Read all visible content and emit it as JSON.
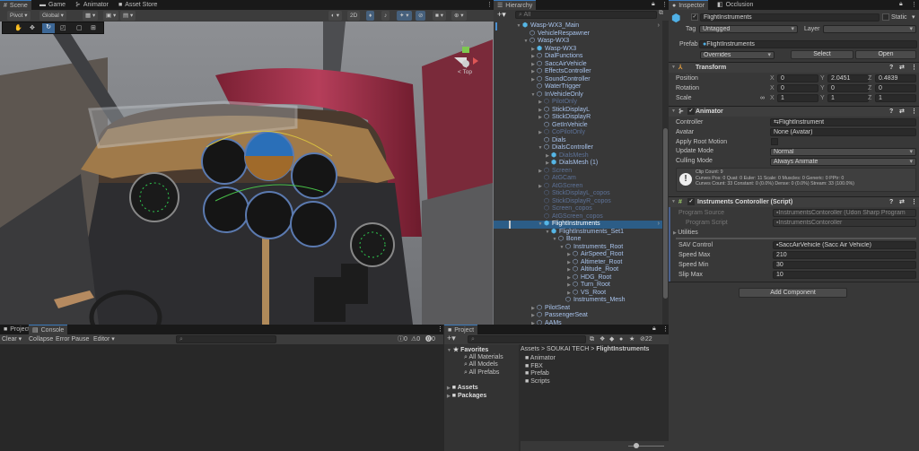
{
  "scene_panel": {
    "tabs": [
      "Scene",
      "Game",
      "Animator",
      "Asset Store"
    ],
    "pivot": "Pivot",
    "global": "Global",
    "btn_2d": "2D",
    "gizmo_label": "< Top",
    "gizmo_y": "Y"
  },
  "hierarchy": {
    "tab": "Hierarchy",
    "search_placeholder": "All",
    "items": [
      {
        "label": "Wasp-WX3_Main",
        "depth": 0,
        "arrow": "down",
        "prefab": true,
        "inactive": false
      },
      {
        "label": "VehicleRespawner",
        "depth": 1,
        "arrow": "",
        "prefab": false,
        "inactive": false
      },
      {
        "label": "Wasp-WX3",
        "depth": 1,
        "arrow": "down",
        "prefab": false,
        "inactive": false
      },
      {
        "label": "Wasp-WX3",
        "depth": 2,
        "arrow": "right",
        "prefab": true,
        "inactive": false
      },
      {
        "label": "DialFunctions",
        "depth": 2,
        "arrow": "right",
        "prefab": false,
        "inactive": false
      },
      {
        "label": "SaccAirVehicle",
        "depth": 2,
        "arrow": "right",
        "prefab": false,
        "inactive": false
      },
      {
        "label": "EffectsController",
        "depth": 2,
        "arrow": "right",
        "prefab": false,
        "inactive": false
      },
      {
        "label": "SoundController",
        "depth": 2,
        "arrow": "right",
        "prefab": false,
        "inactive": false
      },
      {
        "label": "WaterTrigger",
        "depth": 2,
        "arrow": "",
        "prefab": false,
        "inactive": false
      },
      {
        "label": "InVehicleOnly",
        "depth": 2,
        "arrow": "down",
        "prefab": false,
        "inactive": false
      },
      {
        "label": "PilotOnly",
        "depth": 3,
        "arrow": "right",
        "prefab": false,
        "inactive": true
      },
      {
        "label": "StickDisplayL",
        "depth": 3,
        "arrow": "right",
        "prefab": false,
        "inactive": false
      },
      {
        "label": "StickDisplayR",
        "depth": 3,
        "arrow": "right",
        "prefab": false,
        "inactive": false
      },
      {
        "label": "GetInVehicle",
        "depth": 3,
        "arrow": "",
        "prefab": false,
        "inactive": false
      },
      {
        "label": "CoPilotOnly",
        "depth": 3,
        "arrow": "right",
        "prefab": false,
        "inactive": true
      },
      {
        "label": "Dials",
        "depth": 3,
        "arrow": "",
        "prefab": false,
        "inactive": false
      },
      {
        "label": "DialsController",
        "depth": 3,
        "arrow": "down",
        "prefab": false,
        "inactive": false
      },
      {
        "label": "DialsMesh",
        "depth": 4,
        "arrow": "right",
        "prefab": true,
        "inactive": true
      },
      {
        "label": "DialsMesh (1)",
        "depth": 4,
        "arrow": "right",
        "prefab": true,
        "inactive": false
      },
      {
        "label": "Screen",
        "depth": 3,
        "arrow": "right",
        "prefab": false,
        "inactive": true
      },
      {
        "label": "AtGCam",
        "depth": 3,
        "arrow": "",
        "prefab": false,
        "inactive": true
      },
      {
        "label": "AtGScreen",
        "depth": 3,
        "arrow": "right",
        "prefab": false,
        "inactive": true
      },
      {
        "label": "StickDisplayL_copos",
        "depth": 3,
        "arrow": "",
        "prefab": false,
        "inactive": true
      },
      {
        "label": "StickDisplayR_copos",
        "depth": 3,
        "arrow": "",
        "prefab": false,
        "inactive": true
      },
      {
        "label": "Screen_copos",
        "depth": 3,
        "arrow": "",
        "prefab": false,
        "inactive": true
      },
      {
        "label": "AtGScreen_copos",
        "depth": 3,
        "arrow": "",
        "prefab": false,
        "inactive": true
      },
      {
        "label": "FlightInstruments",
        "depth": 3,
        "arrow": "down",
        "prefab": true,
        "inactive": false,
        "selected": true
      },
      {
        "label": "FlightInstruments_Set1",
        "depth": 4,
        "arrow": "down",
        "prefab": true,
        "inactive": false
      },
      {
        "label": "Bone",
        "depth": 5,
        "arrow": "down",
        "prefab": false,
        "inactive": false
      },
      {
        "label": "Instruments_Root",
        "depth": 6,
        "arrow": "down",
        "prefab": false,
        "inactive": false
      },
      {
        "label": "AirSpeed_Root",
        "depth": 7,
        "arrow": "right",
        "prefab": false,
        "inactive": false
      },
      {
        "label": "Altimeter_Root",
        "depth": 7,
        "arrow": "right",
        "prefab": false,
        "inactive": false
      },
      {
        "label": "Altitude_Root",
        "depth": 7,
        "arrow": "right",
        "prefab": false,
        "inactive": false
      },
      {
        "label": "HDG_Root",
        "depth": 7,
        "arrow": "right",
        "prefab": false,
        "inactive": false
      },
      {
        "label": "Turn_Root",
        "depth": 7,
        "arrow": "right",
        "prefab": false,
        "inactive": false
      },
      {
        "label": "VS_Root",
        "depth": 7,
        "arrow": "right",
        "prefab": false,
        "inactive": false
      },
      {
        "label": "Instruments_Mesh",
        "depth": 6,
        "arrow": "",
        "prefab": false,
        "inactive": false
      },
      {
        "label": "PilotSeat",
        "depth": 2,
        "arrow": "right",
        "prefab": false,
        "inactive": false
      },
      {
        "label": "PassengerSeat",
        "depth": 2,
        "arrow": "right",
        "prefab": false,
        "inactive": false
      },
      {
        "label": "AAMs",
        "depth": 2,
        "arrow": "right",
        "prefab": false,
        "inactive": false
      }
    ]
  },
  "inspector": {
    "tabs": [
      "Inspector",
      "Occlusion"
    ],
    "object_name": "FlightInstruments",
    "static_label": "Static",
    "tag_label": "Tag",
    "tag_value": "Untagged",
    "layer_label": "Layer",
    "layer_value": "",
    "prefab_label": "Prefab",
    "prefab_value": "FlightInstruments",
    "overrides": "Overrides",
    "select": "Select",
    "open": "Open",
    "transform": {
      "title": "Transform",
      "position_label": "Position",
      "rotation_label": "Rotation",
      "scale_label": "Scale",
      "position": [
        "0",
        "2.0451",
        "0.4839"
      ],
      "rotation": [
        "0",
        "0",
        "0"
      ],
      "scale": [
        "1",
        "1",
        "1"
      ],
      "axes": [
        "X",
        "Y",
        "Z"
      ]
    },
    "animator": {
      "title": "Animator",
      "controller_label": "Controller",
      "controller": "FlightInstrument",
      "avatar_label": "Avatar",
      "avatar": "None (Avatar)",
      "apply_root_motion_label": "Apply Root Motion",
      "update_mode_label": "Update Mode",
      "update_mode": "Normal",
      "culling_mode_label": "Culling Mode",
      "culling_mode": "Always Animate",
      "info": [
        "Clip Count: 9",
        "Curves Pos: 0 Quat: 0 Euler: 11 Scale: 0 Muscles: 0 Generic: 0 PPtr: 0",
        "Curves Count: 33 Constant: 0 (0.0%) Dense: 0 (0.0%) Stream: 33 (100.0%)"
      ]
    },
    "script": {
      "title": "Instruments Contoroller (Script)",
      "program_source_label": "Program Source",
      "program_source": "InstrumentsContoroller (Udon Sharp Program",
      "program_script_label": "Program Script",
      "program_script": "InstrumentsContoroller",
      "utilities": "Utilities",
      "sav_label": "SAV Control",
      "sav": "SaccAirVehicle (Sacc Air Vehicle)",
      "speed_max_label": "Speed Max",
      "speed_max": "210",
      "speed_min_label": "Speed Min",
      "speed_min": "30",
      "slip_max_label": "Slip Max",
      "slip_max": "10"
    },
    "add_component": "Add Component"
  },
  "console": {
    "tabs": [
      "Project",
      "Console"
    ],
    "clear": "Clear",
    "collapse": "Collapse",
    "error_pause": "Error Pause",
    "editor": "Editor",
    "counts": [
      "0",
      "0",
      "0"
    ]
  },
  "project": {
    "tab": "Project",
    "hidden_count": "22",
    "favorites": "Favorites",
    "fav_items": [
      "All Materials",
      "All Models",
      "All Prefabs"
    ],
    "roots": [
      "Assets",
      "Packages"
    ],
    "breadcrumb": [
      "Assets",
      "SOUKAI TECH",
      "FlightInstruments"
    ],
    "folders": [
      "Animator",
      "FBX",
      "Prefab",
      "Scripts"
    ]
  }
}
